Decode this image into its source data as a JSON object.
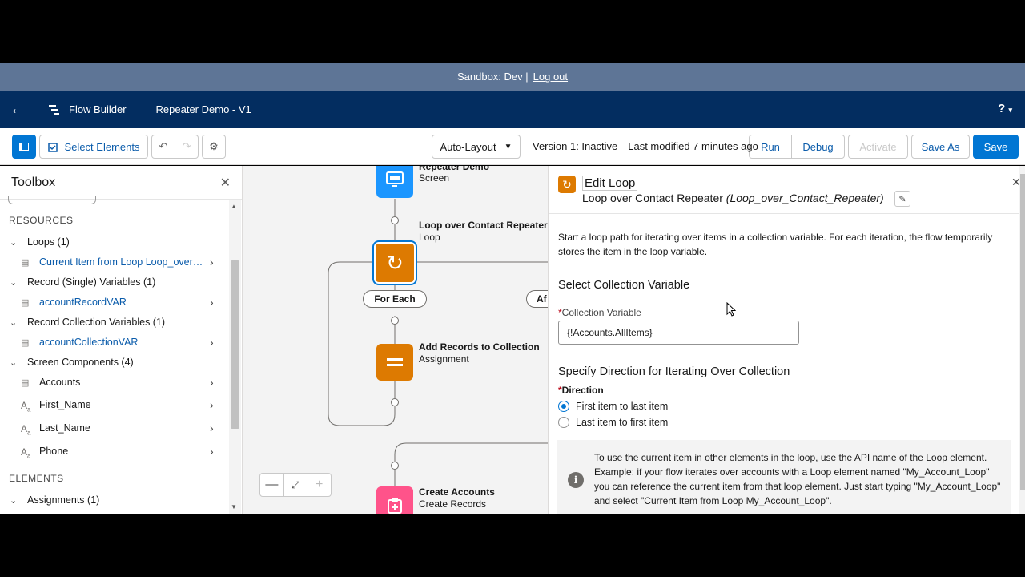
{
  "sandbox": {
    "label": "Sandbox: Dev |",
    "logout": "Log out"
  },
  "header": {
    "app_name": "Flow Builder",
    "flow_name": "Repeater Demo - V1",
    "help": "?"
  },
  "toolbar": {
    "select_elements": "Select Elements",
    "auto_layout": "Auto-Layout",
    "version_text": "Version 1: Inactive—Last modified 7 minutes ago",
    "run": "Run",
    "debug": "Debug",
    "activate": "Activate",
    "save_as": "Save As",
    "save": "Save"
  },
  "toolbox": {
    "title": "Toolbox",
    "resources_label": "RESOURCES",
    "elements_label": "ELEMENTS",
    "groups": [
      {
        "label": "Loops (1)",
        "items": [
          "Current Item from Loop Loop_over_..."
        ]
      },
      {
        "label": "Record (Single) Variables (1)",
        "items": [
          "accountRecordVAR"
        ]
      },
      {
        "label": "Record Collection Variables (1)",
        "items": [
          "accountCollectionVAR"
        ]
      },
      {
        "label": "Screen Components (4)",
        "items": [
          "Accounts",
          "First_Name",
          "Last_Name",
          "Phone"
        ]
      }
    ],
    "element_groups": [
      "Assignments (1)"
    ]
  },
  "canvas": {
    "screen_node": {
      "title": "Repeater Demo",
      "type": "Screen"
    },
    "loop_node": {
      "title": "Loop over Contact Repeater",
      "type": "Loop"
    },
    "for_each": "For Each",
    "after_last": "Af",
    "assign_node": {
      "title": "Add Records to Collection",
      "type": "Assignment"
    },
    "create_node": {
      "title": "Create Accounts",
      "type": "Create Records"
    }
  },
  "panel": {
    "title": "Edit Loop",
    "subtitle_label": "Loop over Contact Repeater",
    "subtitle_api": "(Loop_over_Contact_Repeater)",
    "description": "Start a loop path for iterating over items in a collection variable. For each iteration, the flow temporarily stores the item in the loop variable.",
    "collection_section": "Select Collection Variable",
    "collection_label": "Collection Variable",
    "collection_value": "{!Accounts.AllItems}",
    "direction_section": "Specify Direction for Iterating Over Collection",
    "direction_label": "Direction",
    "direction_options": [
      "First item to last item",
      "Last item to first item"
    ],
    "direction_selected": "First item to last item",
    "info": "To use the current item in other elements in the loop, use the API name of the Loop element. Example: if your flow iterates over accounts with a Loop element named \"My_Account_Loop\" you can reference the current item from that loop element. Just start typing \"My_Account_Loop\" and select \"Current Item from Loop My_Account_Loop\"."
  },
  "colors": {
    "header": "#032d60",
    "sandbox": "#5e7596",
    "brand": "#0176d3",
    "loop": "#dd7a01",
    "screen": "#1b96ff",
    "create": "#ff538a"
  }
}
